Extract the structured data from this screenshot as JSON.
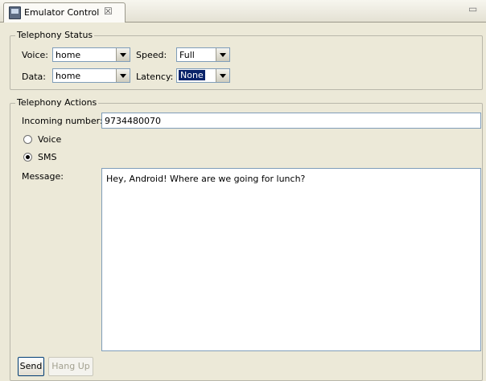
{
  "tab": {
    "title": "Emulator Control",
    "close_glyph": "☒",
    "minimize_glyph": "▭"
  },
  "telephony_status": {
    "title": "Telephony Status",
    "voice_label": "Voice:",
    "voice_value": "home",
    "speed_label": "Speed:",
    "speed_value": "Full",
    "data_label": "Data:",
    "data_value": "home",
    "latency_label": "Latency:",
    "latency_value": "None"
  },
  "telephony_actions": {
    "title": "Telephony Actions",
    "incoming_label": "Incoming number:",
    "incoming_value": "9734480070",
    "radio_voice_label": "Voice",
    "radio_sms_label": "SMS",
    "message_label": "Message:",
    "message_value": "Hey, Android!  Where are we going for lunch?",
    "send_label": "Send",
    "hangup_label": "Hang Up"
  }
}
